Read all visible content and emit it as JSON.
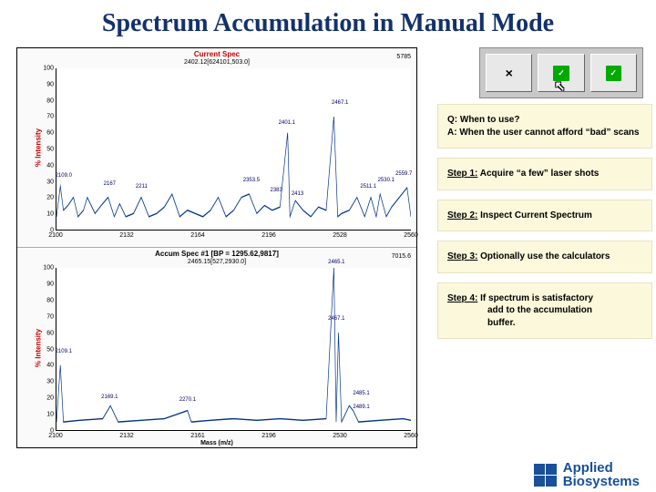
{
  "title": "Spectrum Accumulation in Manual Mode",
  "chart_data": [
    {
      "type": "line",
      "title": "Current Spec",
      "subtitle": "2402.12[624101,503.0]",
      "max_label": "5785",
      "ylabel": "% Intensity",
      "yticks": [
        "100",
        "90",
        "80",
        "70",
        "60",
        "50",
        "40",
        "30",
        "20",
        "10",
        "0"
      ],
      "xticks": [
        "2100",
        "2132",
        "2164",
        "2196",
        "2528",
        "2560"
      ],
      "xlim": [
        2100,
        2560
      ],
      "peaks": [
        {
          "x": 2109.0,
          "y": 27,
          "label": "2109.0"
        },
        {
          "x": 2167,
          "y": 20,
          "label": "2167"
        },
        {
          "x": 2211,
          "y": 20,
          "label": "2211"
        },
        {
          "x": 2353.5,
          "y": 22,
          "label": "2353.5"
        },
        {
          "x": 2383,
          "y": 20,
          "label": "2383"
        },
        {
          "x": 2401.1,
          "y": 60,
          "label": "2401.1"
        },
        {
          "x": 2413,
          "y": 18,
          "label": "2413"
        },
        {
          "x": 2467.1,
          "y": 70,
          "label": "2467.1"
        },
        {
          "x": 2511.1,
          "y": 20,
          "label": "2511.1"
        },
        {
          "x": 2530.1,
          "y": 22,
          "label": "2530.1"
        },
        {
          "x": 2559.7,
          "y": 26,
          "label": "2559.7"
        }
      ],
      "noise_baseline": 8
    },
    {
      "type": "line",
      "title": "Accum Spec #1 [BP = 1295.62,9817]",
      "subtitle": "2465.15[527,2930.0]",
      "max_label": "7015.6",
      "ylabel": "% Intensity",
      "yticks": [
        "100",
        "90",
        "80",
        "70",
        "60",
        "50",
        "40",
        "30",
        "20",
        "10",
        "0"
      ],
      "xticks": [
        "2100",
        "2132",
        "2161",
        "2196",
        "2530",
        "2560"
      ],
      "xlabel": "Mass (m/z)",
      "xlim": [
        2100,
        2560
      ],
      "peaks": [
        {
          "x": 2109.1,
          "y": 40,
          "label": "2109.1"
        },
        {
          "x": 2169.1,
          "y": 15,
          "label": "2169.1"
        },
        {
          "x": 2270.1,
          "y": 12,
          "label": "2270.1"
        },
        {
          "x": 2465.1,
          "y": 100,
          "label": "2465.1"
        },
        {
          "x": 2467.1,
          "y": 60,
          "label": "2467.1"
        },
        {
          "x": 2485.1,
          "y": 15,
          "label": "2485.1"
        },
        {
          "x": 2489.1,
          "y": 12,
          "label": "2489.1"
        }
      ],
      "noise_baseline": 5
    }
  ],
  "notes": {
    "qa_q": "Q: When to use?",
    "qa_a": "A: When the user cannot afford “bad” scans",
    "step1_label": "Step 1:",
    "step1_text": " Acquire “a few” laser shots",
    "step2_label": "Step 2:",
    "step2_text": " Inspect Current Spectrum",
    "step3_label": "Step 3:",
    "step3_text": " Optionally use the calculators",
    "step4_label": "Step 4:",
    "step4_text": " If spectrum is satisfactory",
    "step4_line2": "add to the accumulation",
    "step4_line3": "buffer."
  },
  "toolbar": {
    "btn1": "×",
    "btn2": "✓",
    "btn3": "✓"
  },
  "logo": {
    "line1": "Applied",
    "line2": "Biosystems"
  }
}
